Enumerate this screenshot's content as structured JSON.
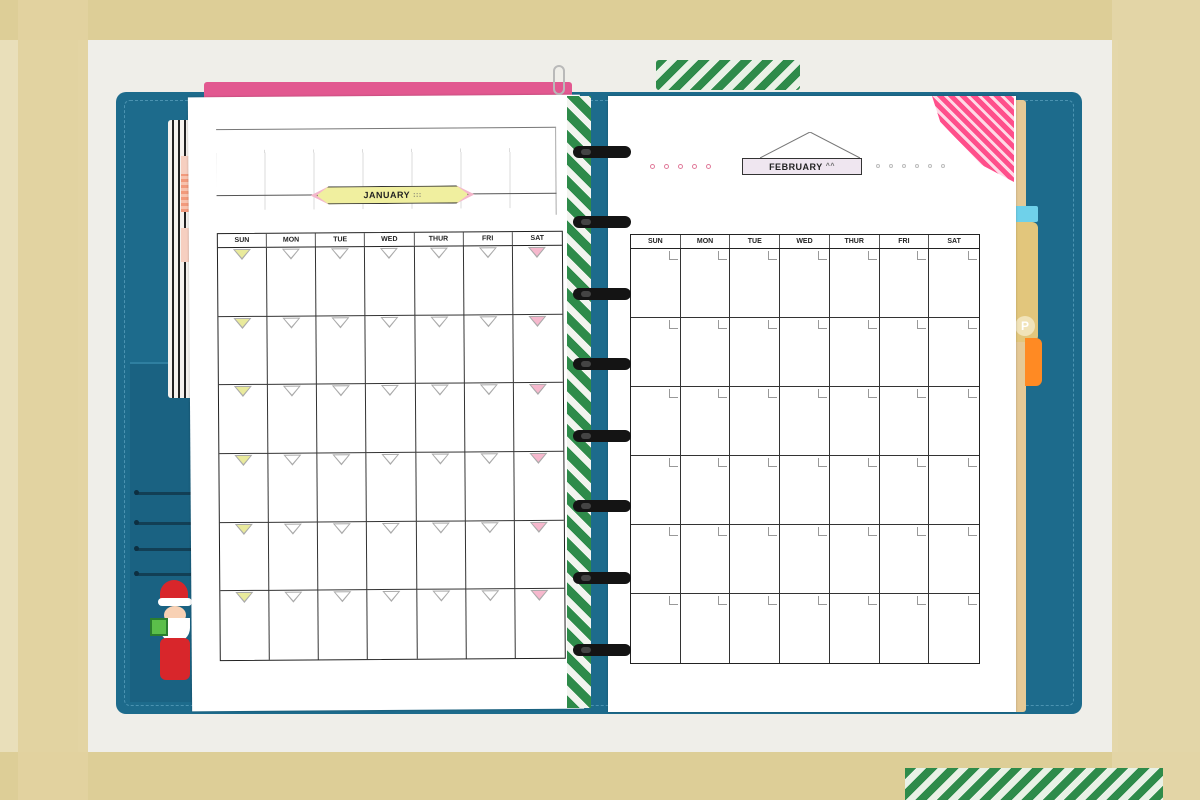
{
  "photo": {
    "subject": "",
    "left_page": {
      "month_label": "JANUARY",
      "month_suffix": ":::",
      "weekdays": [
        "SUN",
        "MON",
        "TUE",
        "WED",
        "THUR",
        "FRI",
        "SAT"
      ],
      "weeks": 6
    },
    "right_page": {
      "month_label": "FEBRUARY",
      "month_suffix": "^^",
      "weekdays": [
        "SUN",
        "MON",
        "TUE",
        "WED",
        "THUR",
        "FRI",
        "SAT"
      ],
      "weeks": 6
    },
    "side_tab_letter": "P"
  },
  "colors": {
    "cover": "#1d6b8c",
    "washi_green": "#2e8b4a",
    "washi_pink": "#ff4f8b",
    "banner_yellow": "#f0ef9f",
    "marker_yellow": "#e9ea9c",
    "marker_pink": "#f6b8cd",
    "tab_orange": "#ff8a23",
    "tab_gold": "#e2c67c"
  }
}
